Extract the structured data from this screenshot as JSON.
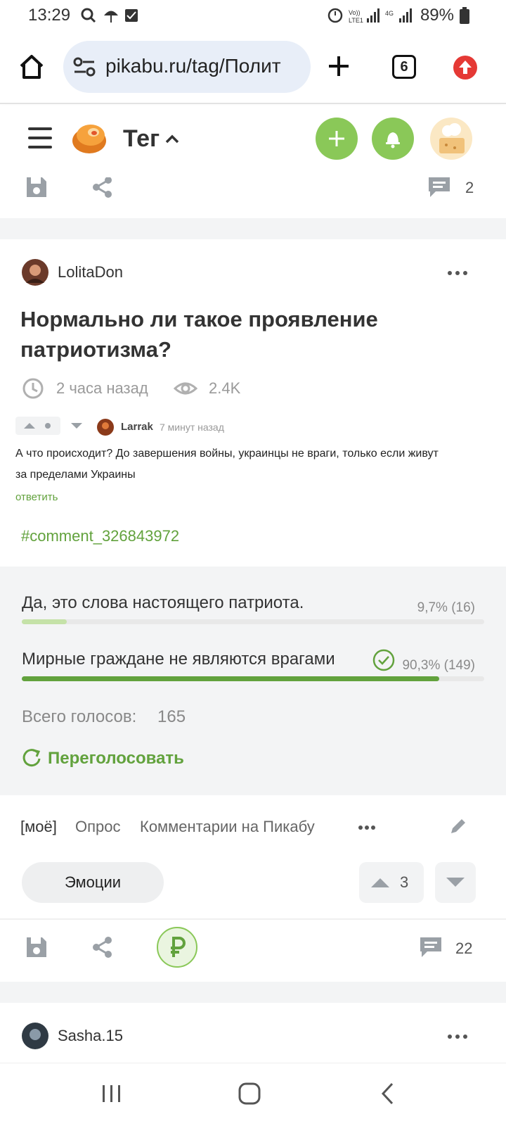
{
  "status_bar": {
    "time": "13:29",
    "battery": "89%"
  },
  "browser": {
    "url": "pikabu.ru/tag/Полит",
    "tab_count": "6"
  },
  "site_header": {
    "title": "Тег"
  },
  "prev_post": {
    "comments_count": "2"
  },
  "post": {
    "author": "LolitaDon",
    "title_line1": "Нормально ли такое проявление",
    "title_line2": "патриотизма?",
    "time_ago": "2 часа назад",
    "views": "2.4K",
    "embedded_comment": {
      "author": "Larrak",
      "time": "7 минут назад",
      "text_line1": "А что происходит? До завершения войны, украинцы не враги, только если живут",
      "text_line2": "за пределами Украины",
      "reply": "ответить"
    },
    "comment_link": "#comment_326843972",
    "poll": {
      "options": [
        {
          "label": "Да, это слова настоящего патриота.",
          "result": "9,7% (16)",
          "percent": 9.7,
          "color": "#c5e2a8"
        },
        {
          "label": "Мирные граждане не являются врагами",
          "result": "90,3% (149)",
          "percent": 90.3,
          "color": "#62a23d"
        }
      ],
      "total_label": "Всего голосов:",
      "total_value": "165",
      "revote": "Переголосовать"
    },
    "tags": [
      "[моё]",
      "Опрос",
      "Комментарии на Пикабу"
    ],
    "emotions": "Эмоции",
    "rating": "3",
    "comments_count": "22"
  },
  "next_post": {
    "author": "Sasha.15"
  },
  "colors": {
    "accent_green": "#8ac858",
    "link_green": "#62a23d",
    "icon_gray": "#9aa0a6"
  }
}
